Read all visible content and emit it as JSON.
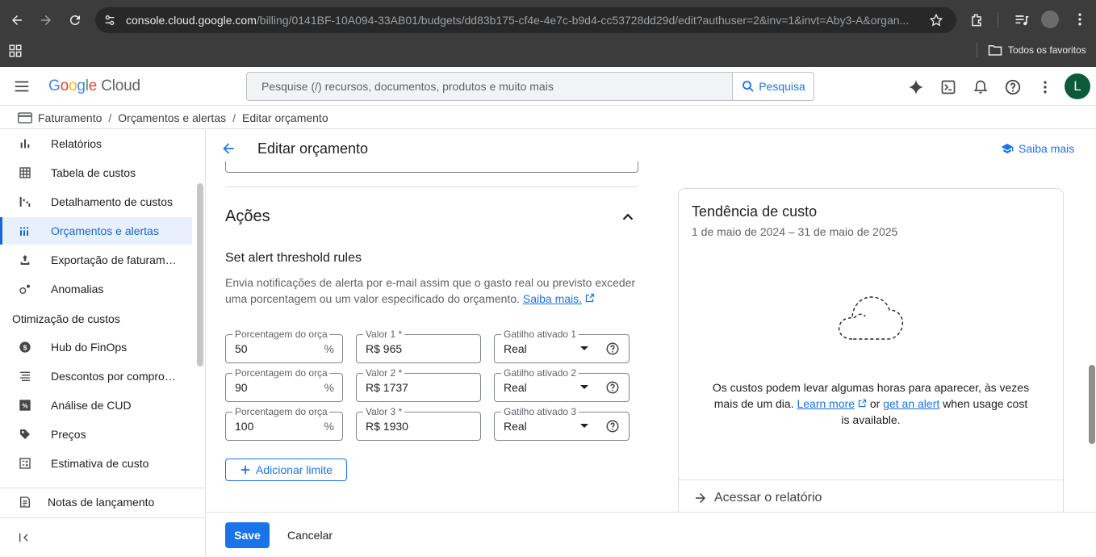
{
  "browser": {
    "url_host": "console.cloud.google.com",
    "url_path": "/billing/0141BF-10A094-33AB01/budgets/dd83b175-cf4e-4e7c-b9d4-cc53728dd29d/edit?authuser=2&inv=1&invt=Aby3-A&organ...",
    "bookmarks_label": "Todos os favoritos"
  },
  "header": {
    "logo_google": "Google",
    "logo_cloud": "Cloud",
    "search_placeholder": "Pesquise (/) recursos, documentos, produtos e muito mais",
    "search_button": "Pesquisa",
    "avatar_letter": "L"
  },
  "breadcrumb": [
    "Faturamento",
    "Orçamentos e alertas",
    "Editar orçamento"
  ],
  "sidebar": {
    "items": [
      {
        "label": "Relatórios",
        "icon": "bar-chart-icon"
      },
      {
        "label": "Tabela de custos",
        "icon": "table-icon"
      },
      {
        "label": "Detalhamento de custos",
        "icon": "breakdown-icon"
      },
      {
        "label": "Orçamentos e alertas",
        "icon": "budget-icon",
        "active": true
      },
      {
        "label": "Exportação de faturam…",
        "icon": "export-icon"
      },
      {
        "label": "Anomalias",
        "icon": "anomaly-icon"
      }
    ],
    "section": "Otimização de custos",
    "section_items": [
      {
        "label": "Hub do FinOps",
        "icon": "dollar-icon"
      },
      {
        "label": "Descontos por compro…",
        "icon": "list-icon"
      },
      {
        "label": "Análise de CUD",
        "icon": "percent-icon"
      },
      {
        "label": "Preços",
        "icon": "tag-icon"
      },
      {
        "label": "Estimativa de custo",
        "icon": "calculator-icon"
      }
    ],
    "footer_item": "Notas de lançamento"
  },
  "main": {
    "title": "Editar orçamento",
    "learn_more": "Saiba mais",
    "actions_title": "Ações",
    "rules_title": "Set alert threshold rules",
    "rules_desc": "Envia notificações de alerta por e-mail assim que o gasto real ou previsto exceder uma porcentagem ou um valor especificado do orçamento.",
    "rules_link": "Saiba mais.",
    "thresholds": [
      {
        "pct_label": "Porcentagem do orça",
        "pct": "50",
        "pct_suffix": "%",
        "amount_label": "Valor 1 *",
        "amount": "R$ 965",
        "trigger_label": "Gatilho ativado 1",
        "trigger": "Real"
      },
      {
        "pct_label": "Porcentagem do orça",
        "pct": "90",
        "pct_suffix": "%",
        "amount_label": "Valor 2 *",
        "amount": "R$ 1737",
        "trigger_label": "Gatilho ativado 2",
        "trigger": "Real"
      },
      {
        "pct_label": "Porcentagem do orça",
        "pct": "100",
        "pct_suffix": "%",
        "amount_label": "Valor 3 *",
        "amount": "R$ 1930",
        "trigger_label": "Gatilho ativado 3",
        "trigger": "Real"
      }
    ],
    "add_threshold": "Adicionar limite",
    "save": "Save",
    "cancel": "Cancelar"
  },
  "card": {
    "title": "Tendência de custo",
    "date_range": "1 de maio de 2024 – 31 de maio de 2025",
    "msg_part1": "Os custos podem levar algumas horas para aparecer, às vezes mais de um dia.",
    "learn_more": "Learn more",
    "or": "or",
    "get_alert": "get an alert",
    "msg_part2": "when usage cost is available.",
    "report_link": "Acessar o relatório"
  },
  "colors": {
    "accent": "#1a73e8",
    "chrome_bg": "#3c3c3c",
    "avatar": "#0b5b3a"
  }
}
